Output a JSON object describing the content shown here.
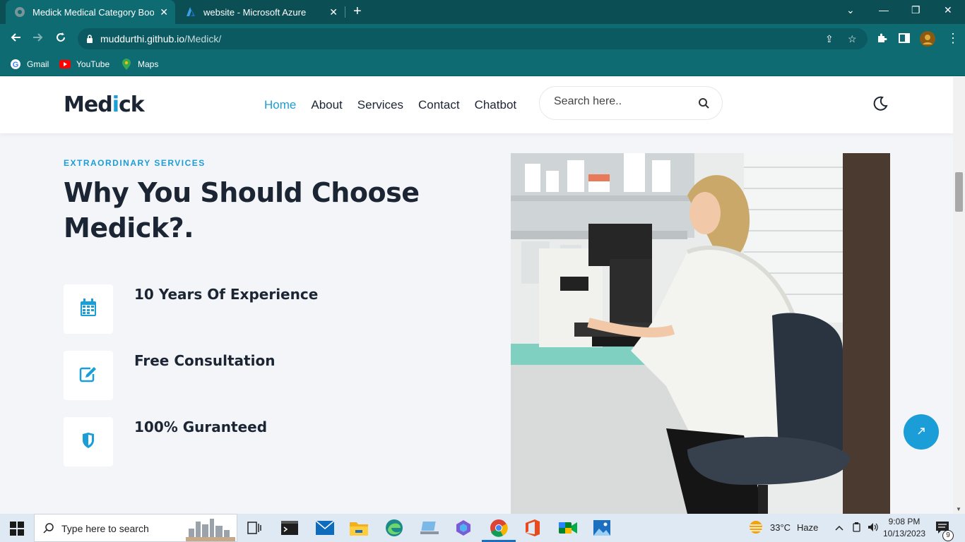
{
  "browser": {
    "tabs": [
      {
        "title": "Medick Medical Category Bootst",
        "active": true
      },
      {
        "title": "website - Microsoft Azure",
        "active": false
      }
    ],
    "url_host": "muddurthi.github.io",
    "url_path": "/Medick/",
    "bookmarks": [
      {
        "label": "Gmail",
        "icon": "gmail-icon"
      },
      {
        "label": "YouTube",
        "icon": "youtube-icon"
      },
      {
        "label": "Maps",
        "icon": "maps-icon"
      }
    ]
  },
  "site": {
    "logo_pre": "Med",
    "logo_hl": "i",
    "logo_post": "ck",
    "nav": [
      "Home",
      "About",
      "Services",
      "Contact",
      "Chatbot"
    ],
    "active_nav": "Home",
    "search_placeholder": "Search here..",
    "eyebrow": "EXTRAORDINARY SERVICES",
    "heading": "Why You Should Choose Medick?.",
    "features": [
      {
        "title": "10 Years Of Experience",
        "icon": "calendar-icon"
      },
      {
        "title": "Free Consultation",
        "icon": "edit-icon"
      },
      {
        "title": "100% Guranteed",
        "icon": "shield-icon"
      }
    ],
    "accent_color": "#1b9ed8"
  },
  "taskbar": {
    "search_placeholder": "Type here to search",
    "weather_temp": "33°C",
    "weather_desc": "Haze",
    "time": "9:08 PM",
    "date": "10/13/2023",
    "notification_count": "9"
  }
}
